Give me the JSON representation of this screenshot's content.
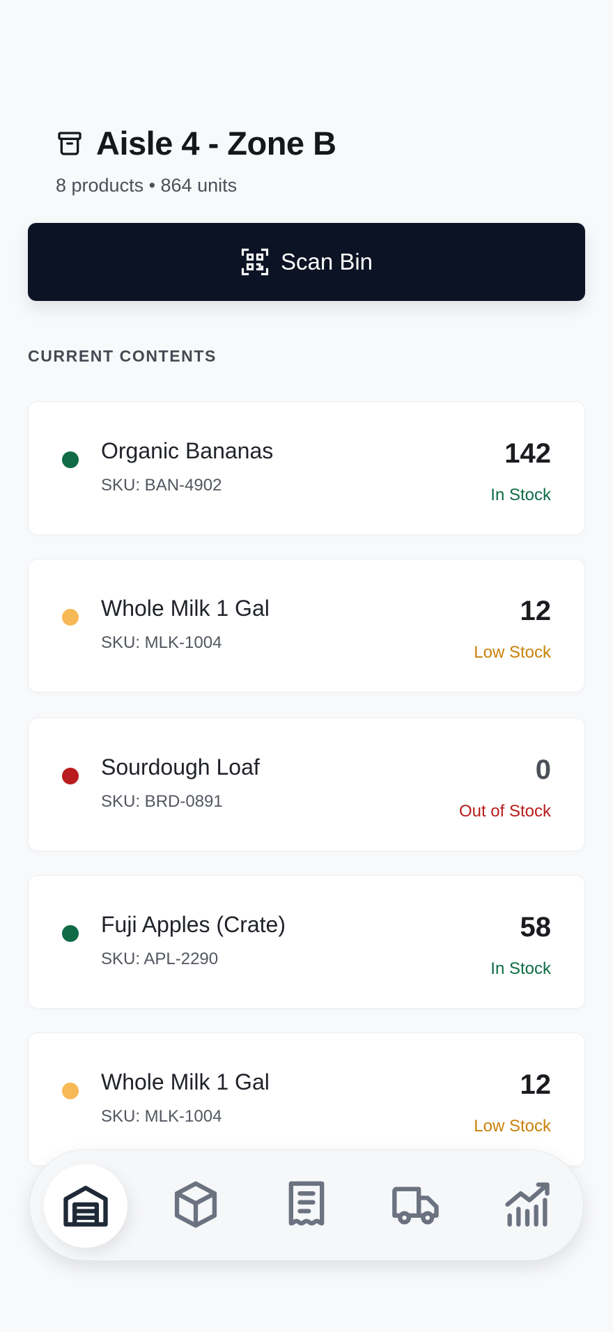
{
  "header": {
    "title": "Aisle 4 - Zone B",
    "subtitle": "8 products • 864 units",
    "icon": "archive-box-icon"
  },
  "scan_button": {
    "label": "Scan Bin",
    "icon": "qr-scan-icon"
  },
  "section": {
    "label": "CURRENT CONTENTS"
  },
  "colors": {
    "in_stock": "#0e6b45",
    "low_stock": "#c9820a",
    "low_dot": "#f7b955",
    "out_of_stock": "#b91c1c",
    "primary": "#0b1324"
  },
  "products": [
    {
      "name": "Organic Bananas",
      "sku": "SKU: BAN-4902",
      "qty": "142",
      "status": "In Stock"
    },
    {
      "name": "Whole Milk 1 Gal",
      "sku": "SKU: MLK-1004",
      "qty": "12",
      "status": "Low Stock"
    },
    {
      "name": "Sourdough Loaf",
      "sku": "SKU: BRD-0891",
      "qty": "0",
      "status": "Out of Stock"
    },
    {
      "name": "Fuji Apples (Crate)",
      "sku": "SKU: APL-2290",
      "qty": "58",
      "status": "In Stock"
    },
    {
      "name": "Whole Milk 1 Gal",
      "sku": "SKU: MLK-1004",
      "qty": "12",
      "status": "Low Stock"
    }
  ],
  "nav": {
    "items": [
      "warehouse-icon",
      "package-icon",
      "receipt-icon",
      "truck-icon",
      "analytics-icon"
    ],
    "active": "warehouse-icon"
  }
}
